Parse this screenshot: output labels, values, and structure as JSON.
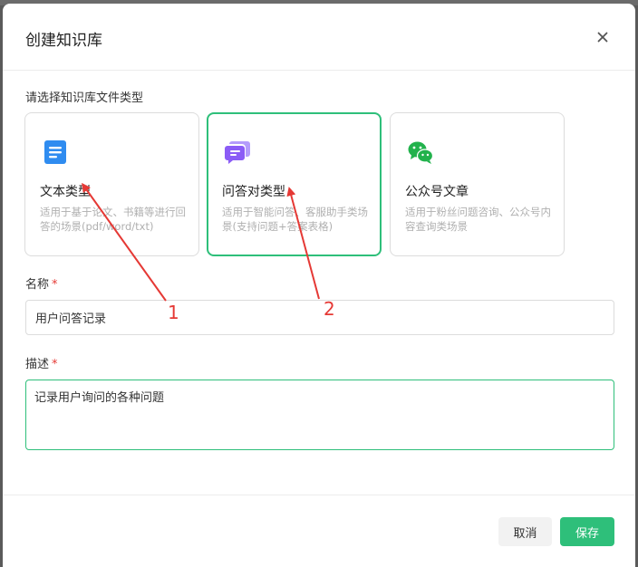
{
  "dialog": {
    "title": "创建知识库",
    "close_icon": "close-icon"
  },
  "type_section": {
    "label": "请选择知识库文件类型",
    "cards": [
      {
        "title": "文本类型",
        "description": "适用于基于论文、书籍等进行回答的场景(pdf/word/txt)",
        "icon": "document-icon",
        "icon_color": "#2f8cf0",
        "selected": false
      },
      {
        "title": "问答对类型",
        "description": "适用于智能问答、客服助手类场景(支持问题+答案表格)",
        "icon": "chat-bubbles-icon",
        "icon_color": "#8b5cf6",
        "selected": true
      },
      {
        "title": "公众号文章",
        "description": "适用于粉丝问题咨询、公众号内容查询类场景",
        "icon": "wechat-icon",
        "icon_color": "#22b24c",
        "selected": false
      }
    ]
  },
  "name_field": {
    "label": "名称",
    "required_mark": "*",
    "value": "用户问答记录"
  },
  "desc_field": {
    "label": "描述",
    "required_mark": "*",
    "value": "记录用户询问的各种问题"
  },
  "footer": {
    "cancel_label": "取消",
    "save_label": "保存"
  },
  "annotations": {
    "marker_1": "1",
    "marker_2": "2",
    "color": "#e53935"
  },
  "colors": {
    "accent": "#2ebf7a",
    "required": "#e53935"
  }
}
